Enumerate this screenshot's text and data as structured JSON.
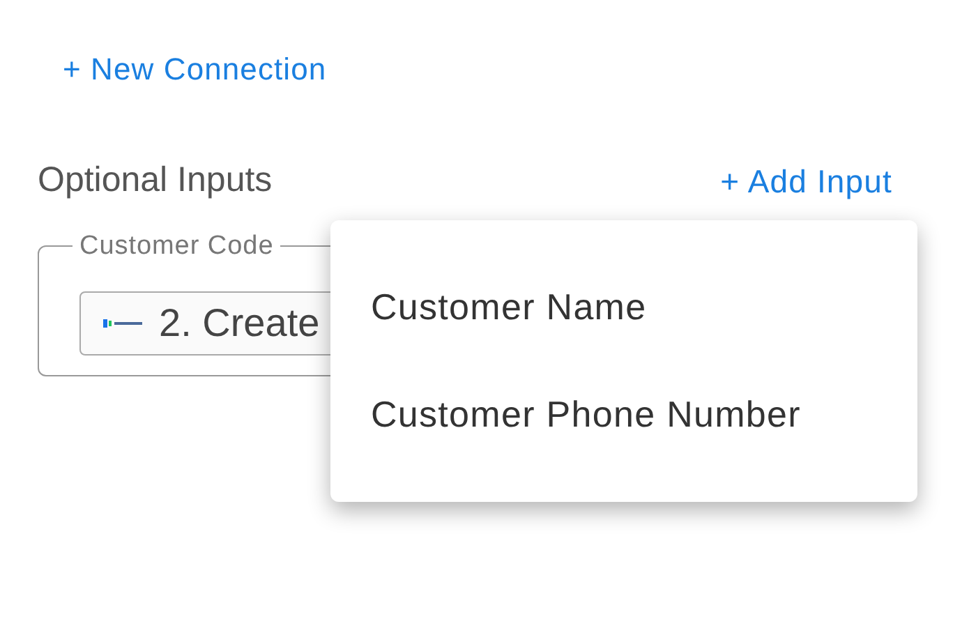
{
  "new_connection": "+ New Connection",
  "optional_inputs": {
    "title": "Optional Inputs",
    "add_input": "+ Add Input"
  },
  "field": {
    "label": "Customer Code",
    "value": "2. Create"
  },
  "menu": {
    "items": [
      {
        "label": "Customer Name"
      },
      {
        "label": "Customer Phone Number"
      }
    ]
  }
}
